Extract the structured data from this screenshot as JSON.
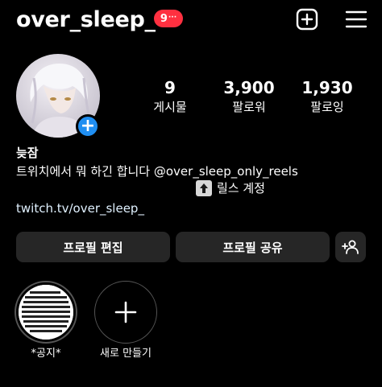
{
  "header": {
    "username": "over_sleep_",
    "notification_count": "9",
    "notification_more": "···",
    "create_icon": "plus-square-icon",
    "menu_icon": "hamburger-menu-icon"
  },
  "profile": {
    "avatar_add_icon": "plus-icon",
    "stats": [
      {
        "value": "9",
        "label": "게시물"
      },
      {
        "value": "3,900",
        "label": "팔로워"
      },
      {
        "value": "1,930",
        "label": "팔로잉"
      }
    ],
    "name": "늦잠",
    "bio_line1": "트위치에서 뭐 하긴 합니다 @over_sleep_only_reels",
    "bio_line2": "릴스 계정",
    "bio_line2_icon": "up-arrow-emoji",
    "link": "twitch.tv/over_sleep_"
  },
  "actions": {
    "edit_label": "프로필 편집",
    "share_label": "프로필 공유",
    "discover_icon": "add-person-icon"
  },
  "highlights": [
    {
      "label": "*공지*",
      "icon": "notice-highlight-cover"
    },
    {
      "label": "새로 만들기",
      "icon": "plus-icon"
    }
  ],
  "colors": {
    "background": "#000000",
    "button_bg": "#262626",
    "badge_red": "#ff3040",
    "accent_blue": "#1f8ef1",
    "link_text": "#e0f1ff"
  }
}
